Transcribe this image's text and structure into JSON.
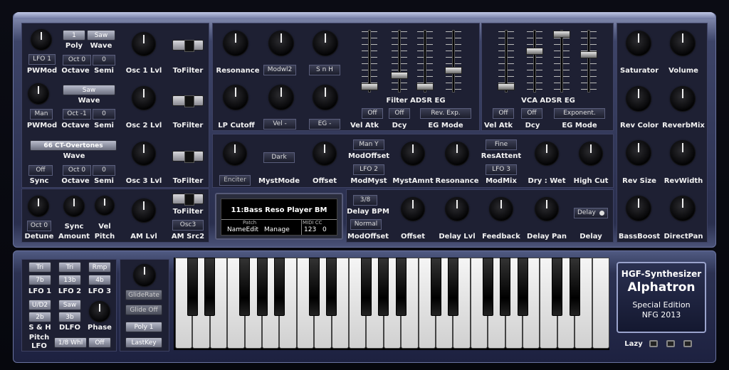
{
  "osc1": {
    "pwmod": "PWMod",
    "lfo": "LFO 1",
    "poly_val": "1",
    "wave_val": "Saw",
    "poly": "Poly",
    "wave": "Wave",
    "oct_val": "Oct 0",
    "semi_val": "0",
    "octave": "Octave",
    "semi": "Semi",
    "lvl": "Osc 1 Lvl",
    "tofilter": "ToFilter"
  },
  "osc2": {
    "man": "Man",
    "pwmod": "PWMod",
    "wave_val": "Saw",
    "wave": "Wave",
    "oct_val": "Oct -1",
    "semi_val": "0",
    "octave": "Octave",
    "semi": "Semi",
    "lvl": "Osc 2 Lvl",
    "tofilter": "ToFilter"
  },
  "osc3": {
    "wave_val": "66 CT-Overtones",
    "wave": "Wave",
    "sync_val": "Off",
    "sync": "Sync",
    "oct_val": "Oct 0",
    "semi_val": "0",
    "octave": "Octave",
    "semi": "Semi",
    "lvl": "Osc 3 Lvl",
    "tofilter": "ToFilter"
  },
  "am": {
    "detune_val": "Oct 0",
    "detune": "Detune",
    "syncamt": "Sync",
    "amount": "Amount",
    "vel": "Vel",
    "pitch": "Pitch",
    "amlvl": "AM Lvl",
    "tofilter": "ToFilter",
    "osc3": "Osc3",
    "amsrc": "AM Src2"
  },
  "filter": {
    "resonance": "Resonance",
    "modwl": "Modwl2",
    "snh": "S n H",
    "lpcutoff": "LP Cutoff",
    "vel": "Vel -",
    "eg": "EG -",
    "adsr": "Filter ADSR EG",
    "velatk_val": "Off",
    "dcy_val": "Off",
    "egmode_val": "Rev. Exp.",
    "velatk": "Vel Atk",
    "dcy": "Dcy",
    "egmode": "EG Mode"
  },
  "vca": {
    "adsr": "VCA ADSR EG",
    "velatk_val": "Off",
    "dcy_val": "Off",
    "egmode_val": "Exponent.",
    "velatk": "Vel Atk",
    "dcy": "Dcy",
    "egmode": "EG Mode"
  },
  "reverb": {
    "saturator": "Saturator",
    "volume": "Volume",
    "revcolor": "Rev Color",
    "reverbmix": "ReverbMix",
    "revsize": "Rev Size",
    "revwidth": "RevWidth",
    "bassboost": "BassBoost",
    "directpan": "DirectPan"
  },
  "myst": {
    "enciter": "Enciter",
    "mystmode": "MystMode",
    "dark": "Dark",
    "offset": "Offset",
    "many": "Man Y",
    "modoffset": "ModOffset",
    "lfo2": "LFO 2",
    "modmyst": "ModMyst",
    "mystamnt": "MystAmnt",
    "resonance": "Resonance",
    "fine": "Fine",
    "resattent": "ResAttent",
    "lfo3": "LFO 3",
    "modmix": "ModMix",
    "drywet": "Dry : Wet",
    "highcut": "High Cut"
  },
  "lcd": {
    "patchname": "11:Bass Reso Player BM",
    "patch": "Patch",
    "midicc": "MIDI CC",
    "nameedit": "NameEdit",
    "manage": "Manage",
    "cc": "123",
    "ccval": "0"
  },
  "delay": {
    "bpm_val": "3/8",
    "bpm": "Delay BPM",
    "normal": "Normal",
    "modoffset": "ModOffset",
    "offset": "Offset",
    "lvl": "Delay Lvl",
    "feedback": "Feedback",
    "pan": "Delay Pan",
    "delay_val": "Delay",
    "delay": "Delay"
  },
  "lfo": {
    "tri1": "Tri",
    "tri2": "Tri",
    "rmp": "Rmp",
    "b7": "7b",
    "b13": "13b",
    "b4": "4b",
    "lfo1": "LFO 1",
    "lfo2": "LFO 2",
    "lfo3": "LFO 3",
    "ud2": "U/D2",
    "saw": "Saw",
    "b2": "2b",
    "b3": "3b",
    "sh": "S & H",
    "dlfo": "DLFO",
    "phase": "Phase",
    "pitch": "Pitch",
    "lfo": "LFO",
    "whl": "1/8 Whl",
    "off": "Off"
  },
  "glide": {
    "rate": "GlideRate",
    "off": "Glide Off",
    "poly": "Poly 1",
    "lastkey": "LastKey"
  },
  "logo": {
    "hgf": "HGF-Synthesizer",
    "name": "Alphatron",
    "edition": "Special Edition",
    "nfg": "NFG 2013",
    "lazy": "Lazy"
  }
}
